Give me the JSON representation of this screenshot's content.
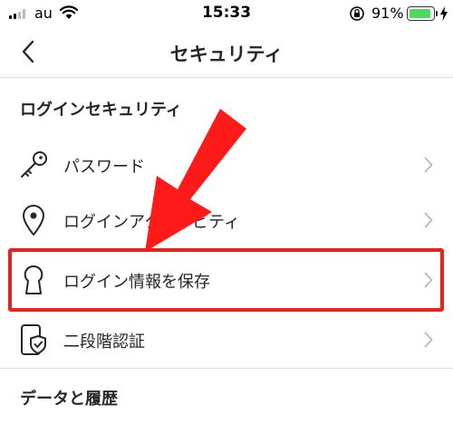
{
  "status_bar": {
    "carrier": "au",
    "time": "15:33",
    "battery_percent": "91%",
    "battery_level": 0.91,
    "icons": [
      "signal-icon",
      "wifi-icon",
      "orientation-lock-icon",
      "battery-icon",
      "charging-bolt-icon"
    ]
  },
  "nav": {
    "title": "セキュリティ",
    "back_icon": "chevron-left-icon"
  },
  "sections": {
    "login_security": {
      "header": "ログインセキュリティ",
      "items": [
        {
          "label": "パスワード",
          "icon": "key-icon"
        },
        {
          "label": "ログインアクティビティ",
          "icon": "location-pin-icon"
        },
        {
          "label": "ログイン情報を保存",
          "icon": "keyhole-icon"
        },
        {
          "label": "二段階認証",
          "icon": "phone-shield-icon"
        }
      ]
    },
    "data_history": {
      "header": "データと履歴"
    }
  },
  "annotations": {
    "highlight_color": "#e8231b",
    "arrow_color": "#ff1a1a"
  }
}
